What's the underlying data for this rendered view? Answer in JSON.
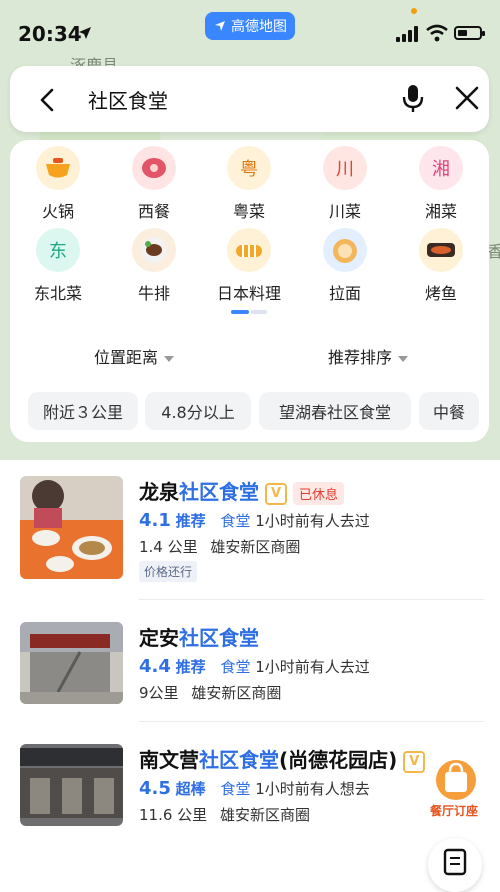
{
  "status_bar": {
    "time": "20:34",
    "app_badge": "高德地图"
  },
  "map": {
    "place_label": "涿鹿县",
    "edge_char": "香"
  },
  "search": {
    "query": "社区食堂"
  },
  "categories": [
    {
      "label": "火锅",
      "icon": "hotpot-icon",
      "glyph": "",
      "bg": "#fff1d6"
    },
    {
      "label": "西餐",
      "icon": "steak-icon",
      "glyph": "",
      "bg": "#ffe4e4"
    },
    {
      "label": "粤菜",
      "icon": "yue-icon",
      "glyph": "粤",
      "bg": "#fff2d9",
      "color": "#e07a10"
    },
    {
      "label": "川菜",
      "icon": "chuan-icon",
      "glyph": "川",
      "bg": "#ffe6e3",
      "color": "#e0452f"
    },
    {
      "label": "湘菜",
      "icon": "xiang-icon",
      "glyph": "湘",
      "bg": "#ffe6ec",
      "color": "#e0457f"
    },
    {
      "label": "东北菜",
      "icon": "dongbei-icon",
      "glyph": "东",
      "bg": "#dcf7ef",
      "color": "#1fa882"
    },
    {
      "label": "牛排",
      "icon": "steak-plate-icon",
      "glyph": "",
      "bg": "#fbeede"
    },
    {
      "label": "日本料理",
      "icon": "sushi-icon",
      "glyph": "",
      "bg": "#fff1d6"
    },
    {
      "label": "拉面",
      "icon": "noodle-icon",
      "glyph": "",
      "bg": "#e3efff"
    },
    {
      "label": "烤鱼",
      "icon": "grilled-fish-icon",
      "glyph": "",
      "bg": "#fff1d6"
    }
  ],
  "sort": {
    "distance": "位置距离",
    "ranking": "推荐排序"
  },
  "filters": [
    "附近３公里",
    "4.8分以上",
    "望湖春社区食堂",
    "中餐"
  ],
  "results": [
    {
      "name_prefix": "龙泉",
      "name_highlight": "社区食堂",
      "name_suffix": "",
      "verified": "V",
      "closed": "已休息",
      "score": "4.1",
      "rating_word": "推荐",
      "type": "食堂",
      "recent": "1小时前有人去过",
      "distance": "1.4 公里",
      "area": "雄安新区商圈",
      "tag": "价格还行"
    },
    {
      "name_prefix": "定安",
      "name_highlight": "社区食堂",
      "name_suffix": "",
      "score": "4.4",
      "rating_word": "推荐",
      "type": "食堂",
      "recent": "1小时前有人去过",
      "distance": "9公里",
      "area": "雄安新区商圈"
    },
    {
      "name_prefix": "南文营",
      "name_highlight": "社区食堂",
      "name_suffix": "(尚德花园店)",
      "verified": "V",
      "score": "4.5",
      "rating_word": "超棒",
      "type": "食堂",
      "recent": "1小时前有人想去",
      "distance": "11.6 公里",
      "area": "雄安新区商圈"
    }
  ],
  "fab": {
    "order_label": "餐厅订座"
  },
  "colors": {
    "accent": "#2f6fe4",
    "closed_red": "#e03b2f"
  }
}
